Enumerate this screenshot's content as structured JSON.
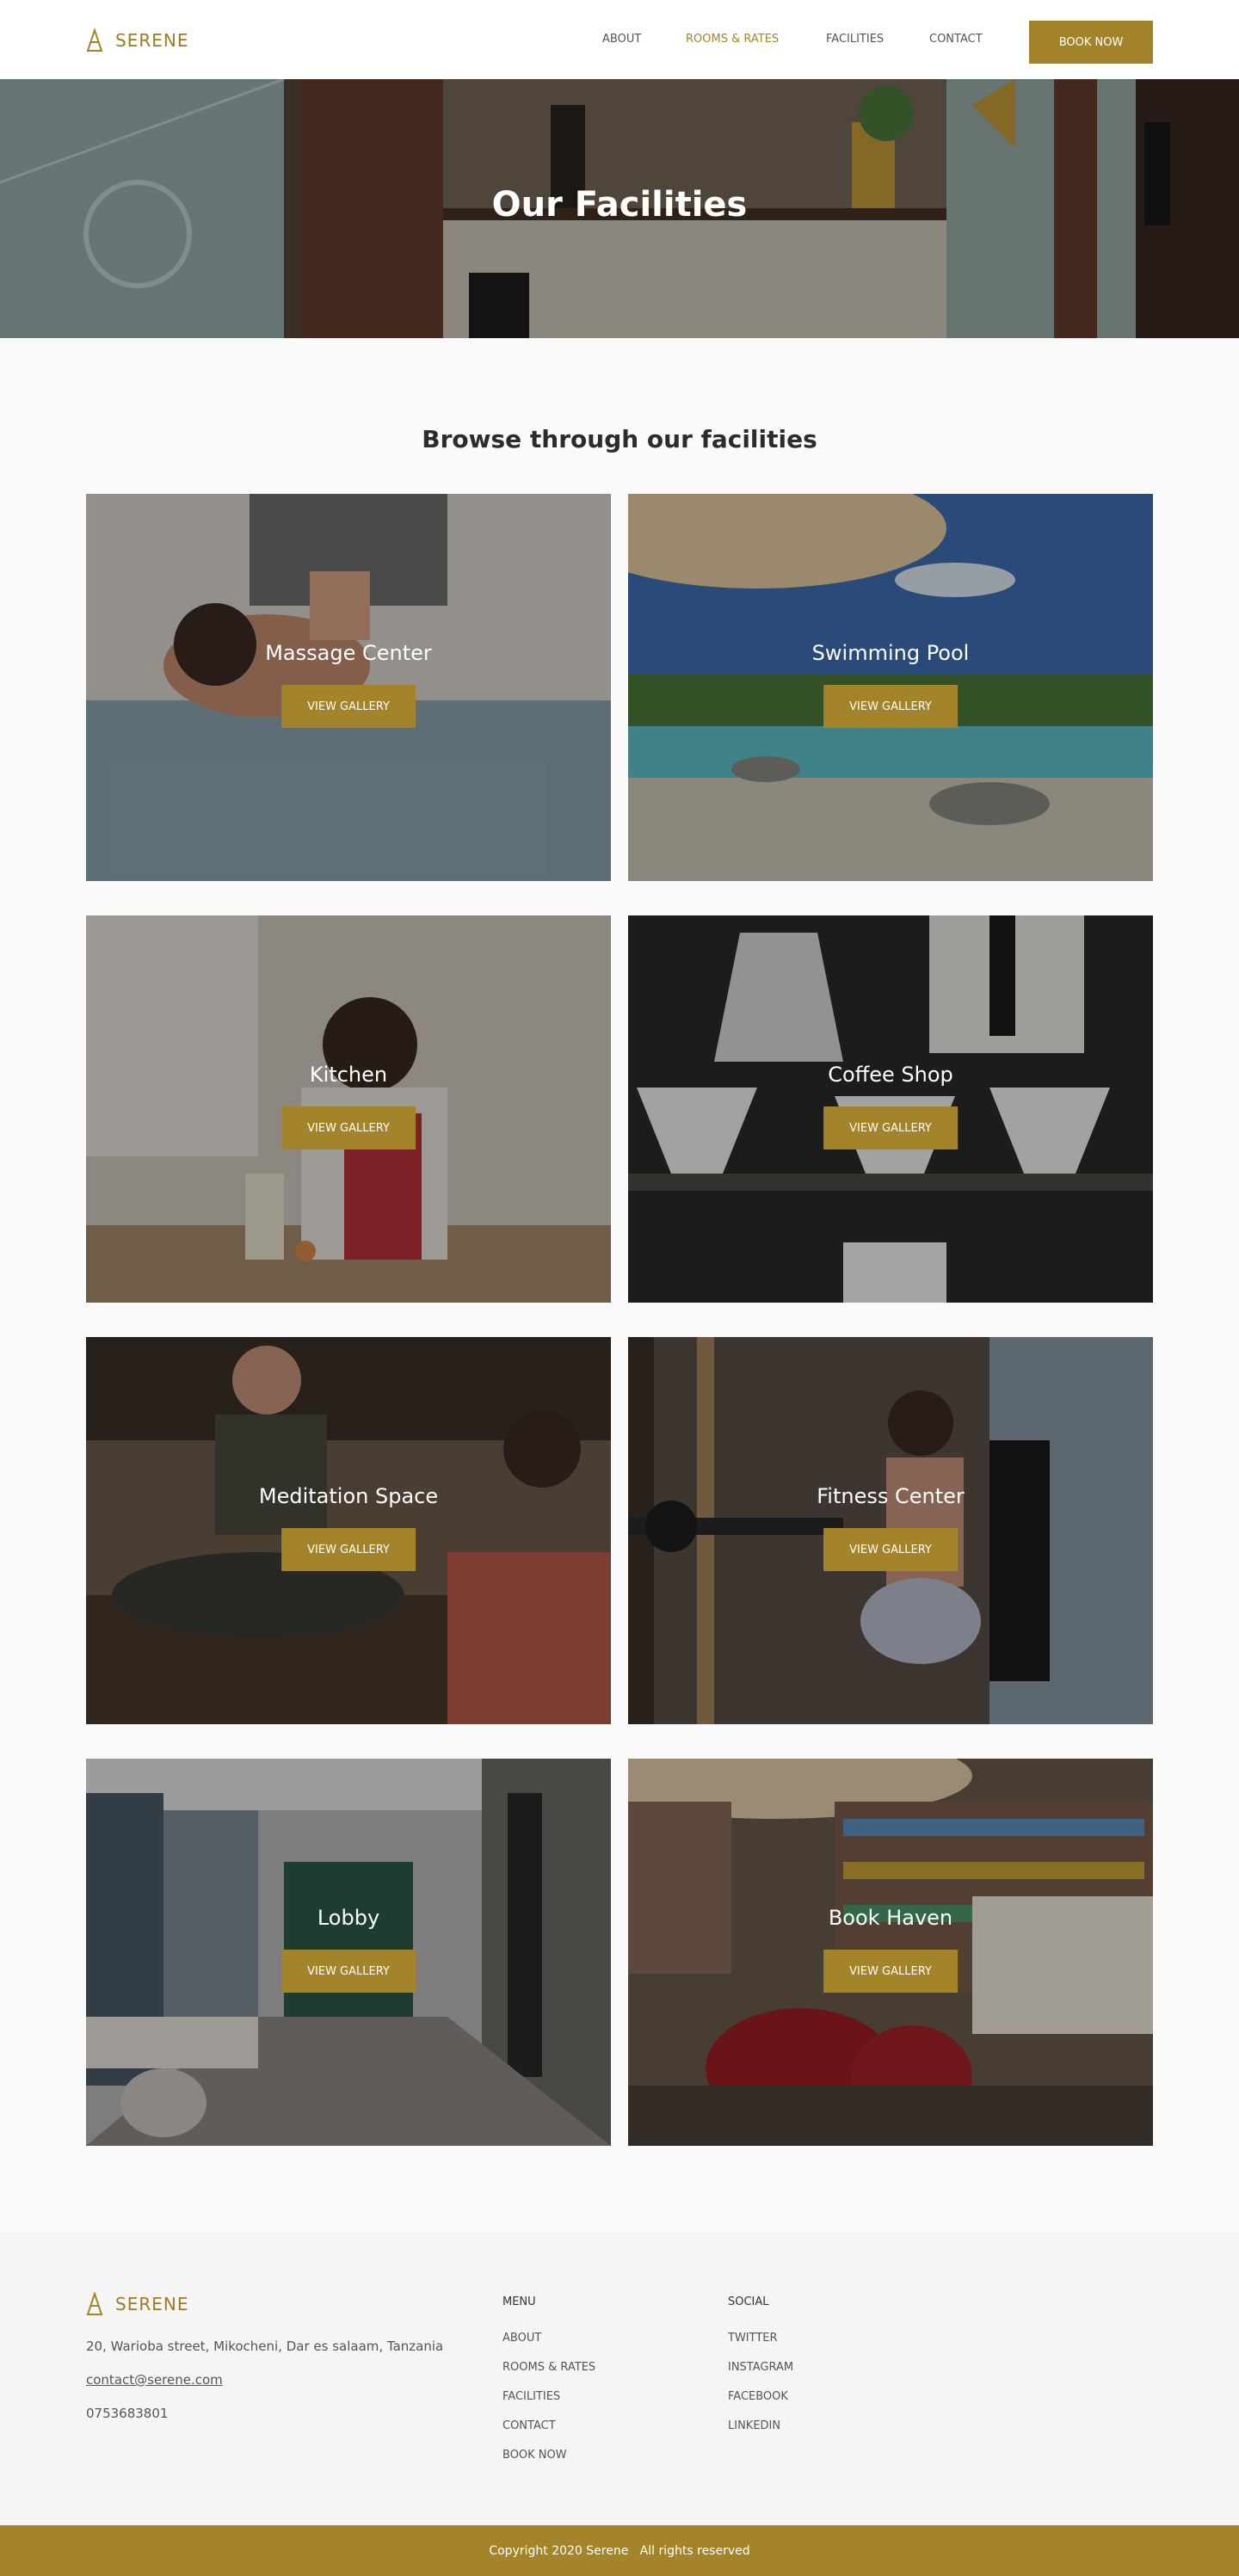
{
  "header": {
    "logo": "SERENE",
    "nav": [
      "ABOUT",
      "ROOMS & RATES",
      "FACILITIES",
      "CONTACT"
    ],
    "active_nav": "ROOMS & RATES",
    "book_now": "BOOK NOW"
  },
  "hero": {
    "title": "Our Facilities"
  },
  "main": {
    "section_title": "Browse through our facilities",
    "button_label": "VIEW GALLERY",
    "cards": [
      {
        "title": "Massage Center"
      },
      {
        "title": "Swimming Pool"
      },
      {
        "title": "Kitchen"
      },
      {
        "title": "Coffee Shop"
      },
      {
        "title": "Meditation Space"
      },
      {
        "title": "Fitness Center"
      },
      {
        "title": "Lobby"
      },
      {
        "title": "Book Haven"
      }
    ]
  },
  "footer": {
    "logo": "SERENE",
    "address": "20, Warioba street, Mikocheni, Dar es salaam, Tanzania",
    "email": "contact@serene.com",
    "phone": "0753683801",
    "menu_heading": "MENU",
    "menu": [
      "ABOUT",
      "ROOMS & RATES",
      "FACILITIES",
      "CONTACT",
      "BOOK NOW"
    ],
    "social_heading": "SOCIAL",
    "social": [
      "TWITTER",
      "INSTAGRAM",
      "FACEBOOK",
      "LINKEDIN"
    ],
    "copyright": "Copyright 2020 Serene   All rights reserved"
  },
  "colors": {
    "accent": "#a4842a",
    "logo": "#9c7b22"
  }
}
